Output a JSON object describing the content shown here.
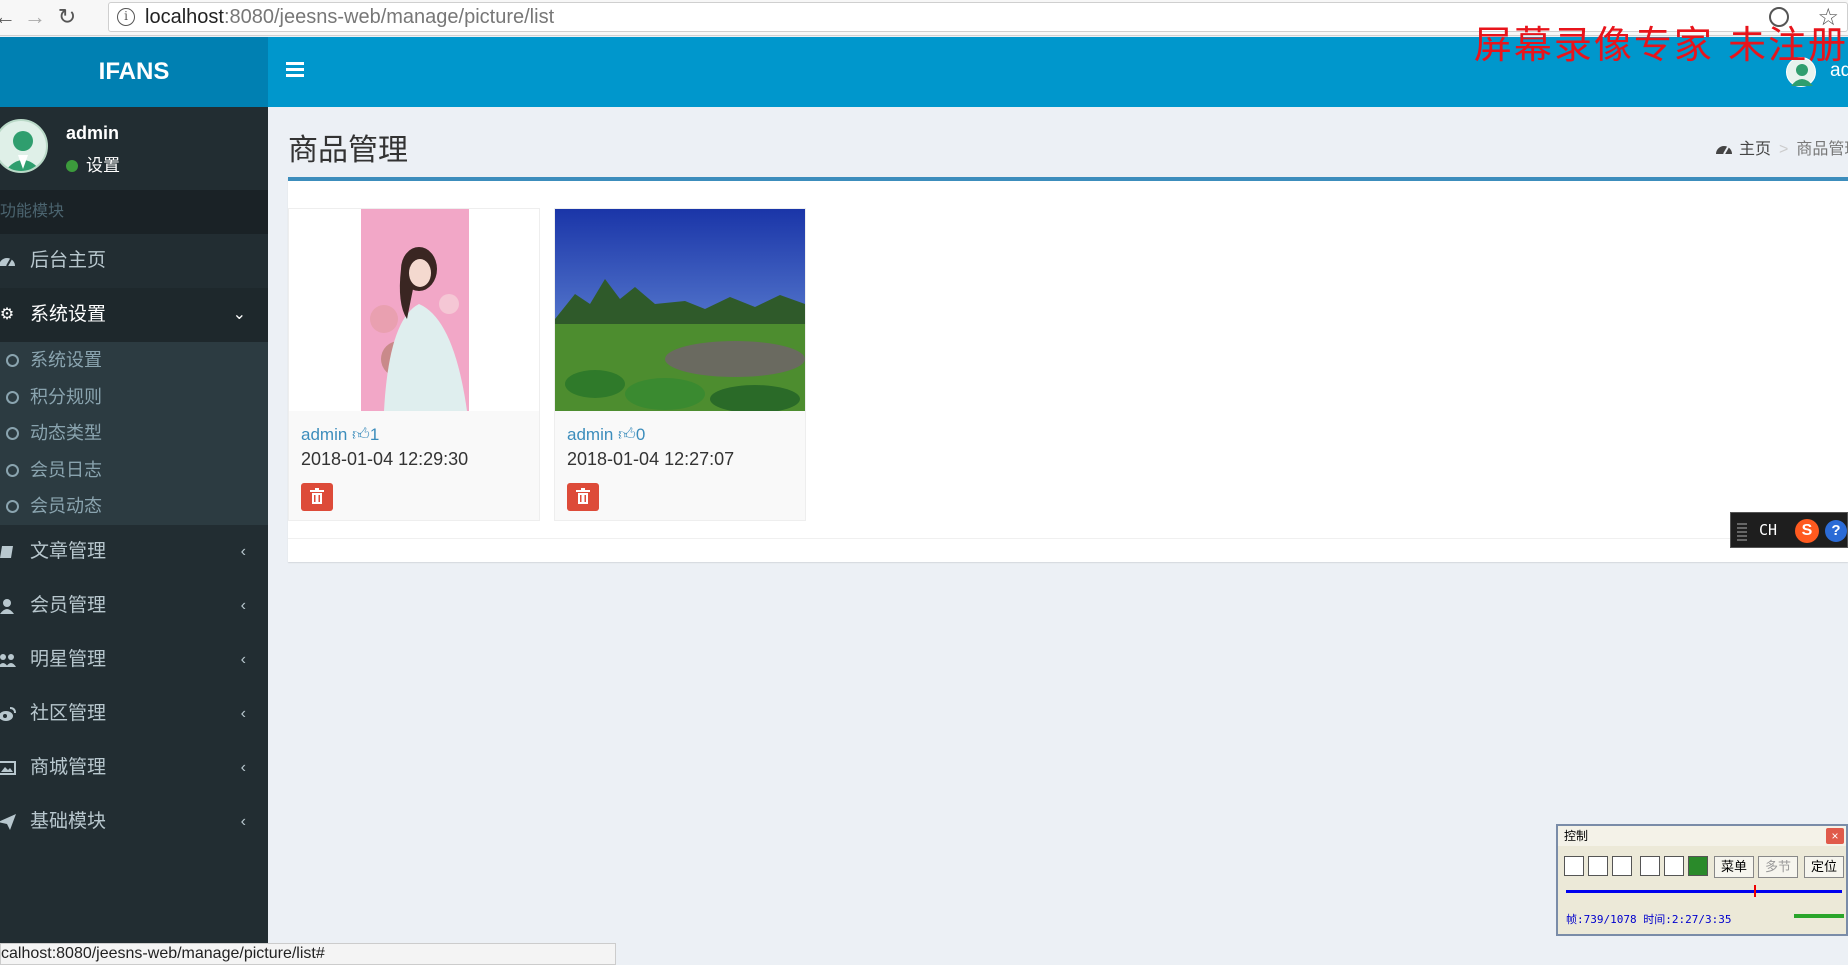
{
  "browser": {
    "url_host": "localhost",
    "url_path": ":8080/jeesns-web/manage/picture/list",
    "status_url": "calhost:8080/jeesns-web/manage/picture/list#"
  },
  "watermark": "屏幕录像专家 未注册",
  "header": {
    "logo": "IFANS",
    "user": "ad"
  },
  "sidebar": {
    "user_name": "admin",
    "user_status": "设置",
    "section_header": "功能模块",
    "items": [
      {
        "label": "后台主页",
        "icon": "dashboard-icon"
      },
      {
        "label": "系统设置",
        "icon": "gear-icon",
        "active": true,
        "children": [
          "系统设置",
          "积分规则",
          "动态类型",
          "会员日志",
          "会员动态"
        ]
      },
      {
        "label": "文章管理",
        "icon": "book-icon"
      },
      {
        "label": "会员管理",
        "icon": "user-icon"
      },
      {
        "label": "明星管理",
        "icon": "users-icon"
      },
      {
        "label": "社区管理",
        "icon": "weibo-icon"
      },
      {
        "label": "商城管理",
        "icon": "picture-icon"
      },
      {
        "label": "基础模块",
        "icon": "paper-plane-icon"
      }
    ]
  },
  "content": {
    "title": "商品管理",
    "breadcrumb": {
      "home": "主页",
      "current": "商品管理"
    },
    "cards": [
      {
        "author": "admin",
        "likes": "1",
        "date": "2018-01-04 12:29:30"
      },
      {
        "author": "admin",
        "likes": "0",
        "date": "2018-01-04 12:27:07"
      }
    ]
  },
  "ime": {
    "lang": "CH",
    "logo": "S",
    "help": "?"
  },
  "recorder": {
    "title": "控制",
    "menu_label": "菜单",
    "multi_label": "多节",
    "locate_label": "定位",
    "status": "帧:739/1078 时间:2:27/3:35"
  },
  "colors": {
    "header": "#0097cc",
    "logo_bg": "#0080b2",
    "sidebar": "#222d32",
    "accent": "#3c8dbc",
    "danger": "#dd4b39"
  }
}
